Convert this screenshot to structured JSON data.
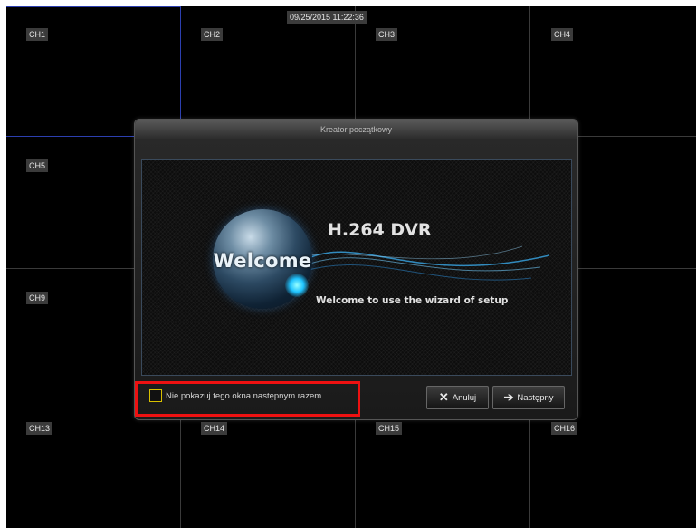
{
  "timestamp": "09/25/2015 11:22:36",
  "channels": [
    "CH1",
    "CH2",
    "CH3",
    "CH4",
    "CH5",
    "CH9",
    "CH13",
    "CH14",
    "CH15",
    "CH16"
  ],
  "dialog": {
    "title": "Kreator początkowy",
    "banner": {
      "welcome": "Welcome",
      "product": "H.264 DVR",
      "subtitle": "Welcome to use the wizard of setup"
    },
    "checkbox_label": "Nie pokazuj tego okna następnym razem.",
    "checkbox_checked": false,
    "cancel_label": "Anuluj",
    "next_label": "Następny"
  },
  "colors": {
    "highlight": "#ee1111",
    "selection_border": "#2c3fb0",
    "checkbox_border": "#d8c000"
  }
}
